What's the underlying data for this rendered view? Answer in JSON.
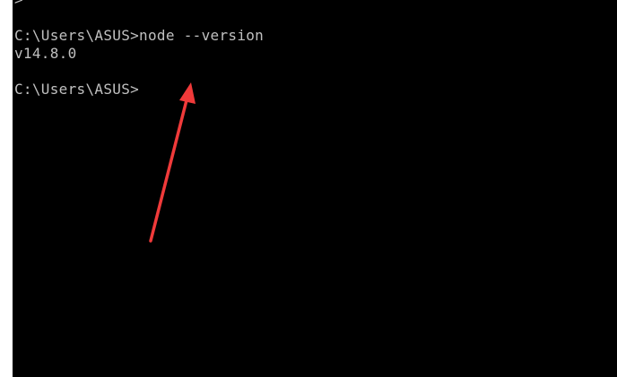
{
  "terminal": {
    "top_glyph": ">",
    "lines": [
      "C:\\Users\\ASUS>node --version",
      "v14.8.0",
      "C:\\Users\\ASUS>"
    ]
  },
  "colors": {
    "terminal_background": "#000000",
    "terminal_text": "#c0c0c0",
    "annotation_arrow": "#f03a3a",
    "page_background": "#ffffff"
  },
  "annotation": {
    "icon": "arrow-up-icon"
  }
}
